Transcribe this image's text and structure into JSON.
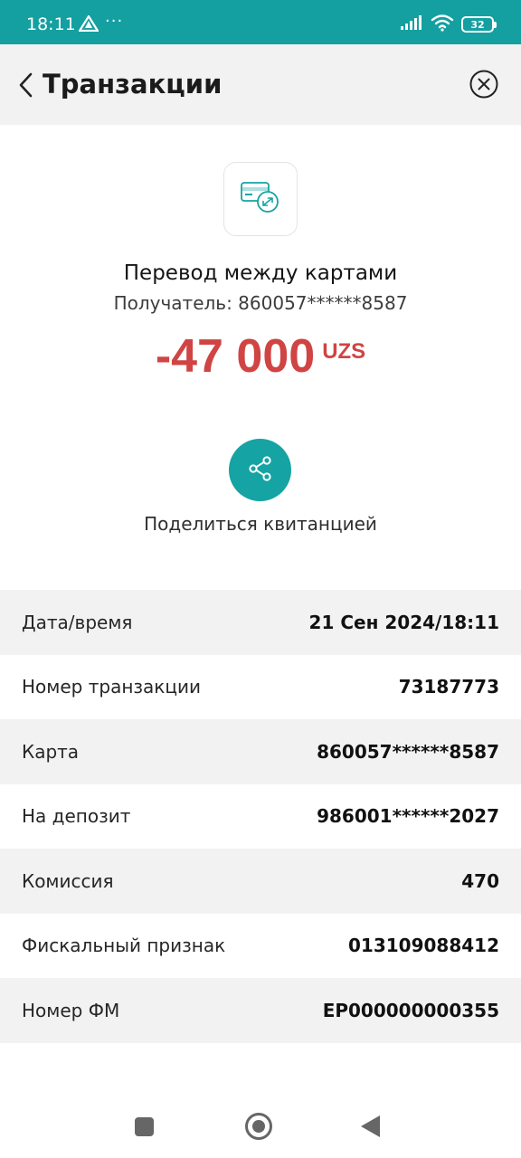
{
  "status_bar": {
    "time": "18:11",
    "dots": "···",
    "battery": "32"
  },
  "header": {
    "title": "Транзакции"
  },
  "transaction": {
    "type": "Перевод между картами",
    "recipient": "Получатель: 860057******8587",
    "amount": "-47 000",
    "currency": "UZS"
  },
  "share": {
    "label": "Поделиться квитанцией"
  },
  "details": [
    {
      "label": "Дата/время",
      "value": "21 Сен 2024/18:11"
    },
    {
      "label": "Номер транзакции",
      "value": "73187773"
    },
    {
      "label": "Карта",
      "value": "860057******8587"
    },
    {
      "label": "На депозит",
      "value": "986001******2027"
    },
    {
      "label": "Комиссия",
      "value": "470"
    },
    {
      "label": "Фискальный признак",
      "value": "013109088412"
    },
    {
      "label": "Номер ФМ",
      "value": "EP000000000355"
    }
  ],
  "colors": {
    "accent": "#15a3a3",
    "amount": "#d04444",
    "status_bar": "#14a0a0"
  },
  "icons": {
    "back": "chevron-left-icon",
    "close": "close-circle-icon",
    "transaction": "card-transfer-icon",
    "share": "share-icon"
  }
}
